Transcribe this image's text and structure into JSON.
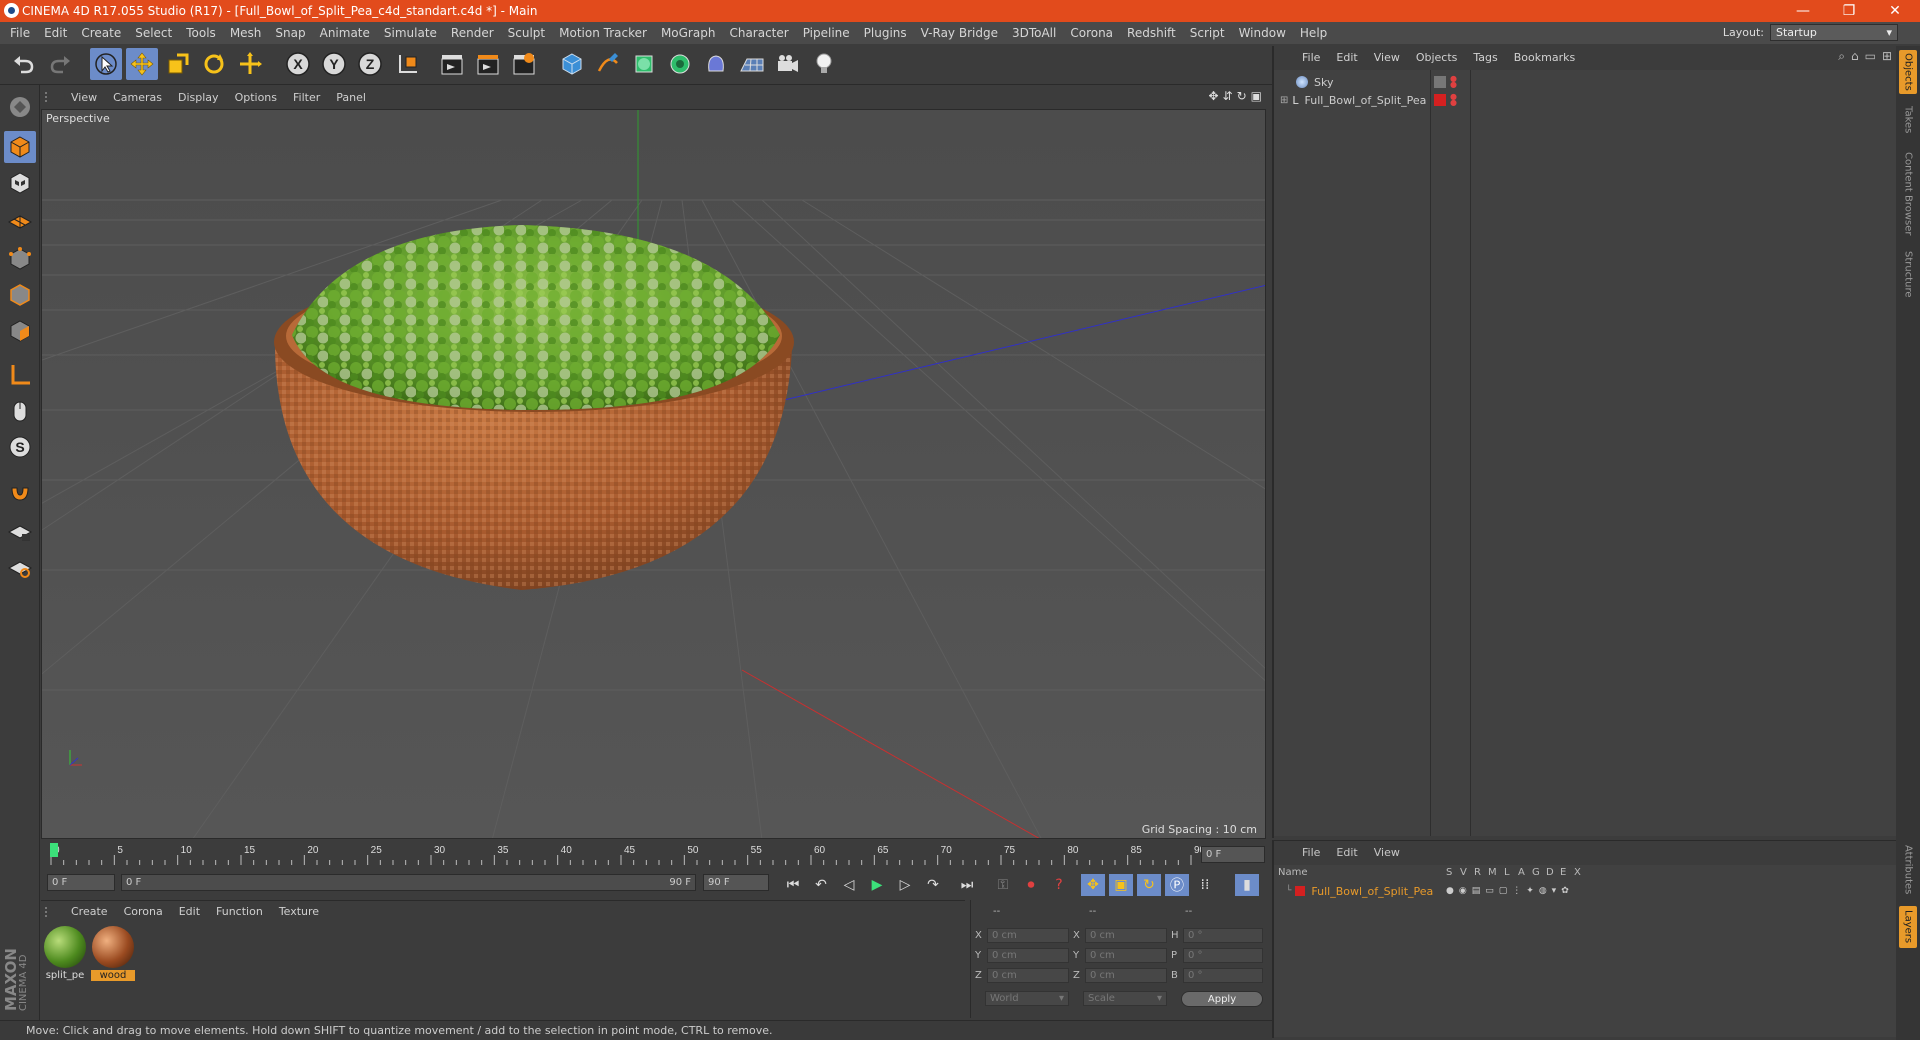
{
  "window": {
    "title": "CINEMA 4D R17.055 Studio (R17) - [Full_Bowl_of_Split_Pea_c4d_standart.c4d *] - Main",
    "minimize": "—",
    "restore": "❐",
    "close": "✕"
  },
  "menu": [
    "File",
    "Edit",
    "Create",
    "Select",
    "Tools",
    "Mesh",
    "Snap",
    "Animate",
    "Simulate",
    "Render",
    "Sculpt",
    "Motion Tracker",
    "MoGraph",
    "Character",
    "Pipeline",
    "Plugins",
    "V-Ray Bridge",
    "3DToAll",
    "Corona",
    "Redshift",
    "Script",
    "Window",
    "Help"
  ],
  "layout": {
    "label": "Layout:",
    "value": "Startup"
  },
  "toolbar": {
    "x_axis": "X",
    "y_axis": "Y",
    "z_axis": "Z"
  },
  "viewport": {
    "menu": [
      "View",
      "Cameras",
      "Display",
      "Options",
      "Filter",
      "Panel"
    ],
    "label": "Perspective",
    "grid_spacing": "Grid Spacing : 10 cm"
  },
  "timeline": {
    "ticks": [
      "0",
      "5",
      "10",
      "15",
      "20",
      "25",
      "30",
      "35",
      "40",
      "45",
      "50",
      "55",
      "60",
      "65",
      "70",
      "75",
      "80",
      "85",
      "90"
    ],
    "current_frame": "0 F",
    "start": "0 F",
    "range_start": "0 F",
    "range_end": "90 F",
    "end": "90 F"
  },
  "materials": {
    "menu": [
      "Create",
      "Corona",
      "Edit",
      "Function",
      "Texture"
    ],
    "items": [
      {
        "name": "split_pe",
        "selected": false
      },
      {
        "name": "wood",
        "selected": true
      }
    ]
  },
  "coords": {
    "headers": [
      "--",
      "--",
      "--"
    ],
    "rows": [
      {
        "a": "X",
        "av": "0 cm",
        "b": "X",
        "bv": "0 cm",
        "c": "H",
        "cv": "0 °"
      },
      {
        "a": "Y",
        "av": "0 cm",
        "b": "Y",
        "bv": "0 cm",
        "c": "P",
        "cv": "0 °"
      },
      {
        "a": "Z",
        "av": "0 cm",
        "b": "Z",
        "bv": "0 cm",
        "c": "B",
        "cv": "0 °"
      }
    ],
    "world": "World",
    "scale": "Scale",
    "apply": "Apply"
  },
  "objects": {
    "menu": [
      "File",
      "Edit",
      "View",
      "Objects",
      "Tags",
      "Bookmarks"
    ],
    "items": [
      {
        "name": "Sky"
      },
      {
        "name": "Full_Bowl_of_Split_Pea"
      }
    ]
  },
  "layers": {
    "menu": [
      "File",
      "Edit",
      "View"
    ],
    "header_name": "Name",
    "columns": [
      "S",
      "V",
      "R",
      "M",
      "L",
      "A",
      "G",
      "D",
      "E",
      "X"
    ],
    "row_name": "Full_Bowl_of_Split_Pea"
  },
  "right_tabs": [
    "Objects",
    "Takes",
    "Content Browser",
    "Structure",
    "Attributes",
    "Layers"
  ],
  "status": "Move: Click and drag to move elements. Hold down SHIFT to quantize movement / add to the selection in point mode, CTRL to remove.",
  "brand": {
    "maxon": "MAXON",
    "product": "CINEMA 4D"
  },
  "colors": {
    "titlebar": "#e24b1c",
    "accent": "#6c8cc9",
    "selection": "#e89a2a",
    "object_red": "#d42020"
  }
}
